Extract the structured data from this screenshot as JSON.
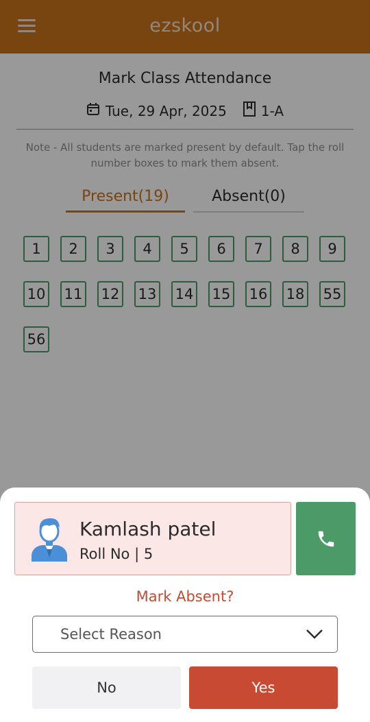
{
  "appbar": {
    "title": "ezskool",
    "menu_icon": "hamburger-menu-icon"
  },
  "page": {
    "title": "Mark Class Attendance",
    "date": "Tue, 29 Apr, 2025",
    "class_name": "1-A",
    "note": "Note - All students are marked present by default. Tap the roll number boxes to mark them absent."
  },
  "tabs": {
    "present": "Present(19)",
    "absent": "Absent(0)"
  },
  "roll_numbers": [
    "1",
    "2",
    "3",
    "4",
    "5",
    "6",
    "7",
    "8",
    "9",
    "10",
    "11",
    "12",
    "13",
    "14",
    "15",
    "16",
    "18",
    "55",
    "56"
  ],
  "sheet": {
    "student_name": "Kamlash patel",
    "student_roll": "Roll No | 5",
    "question": "Mark Absent?",
    "select_placeholder": "Select Reason",
    "no_label": "No",
    "yes_label": "Yes"
  },
  "colors": {
    "brand": "#c9731b",
    "present_box": "#4c9a68",
    "danger": "#c94a33",
    "call": "#4c9a68"
  }
}
